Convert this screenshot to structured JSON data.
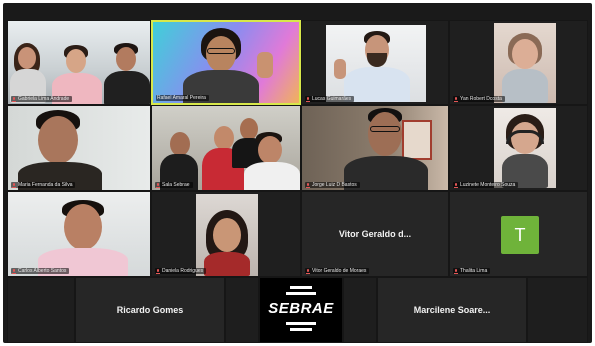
{
  "participants": [
    {
      "name": "Gabriela Lima Andrade",
      "muted": true
    },
    {
      "name": "Yan Robert Dcosta",
      "muted": true
    },
    {
      "name": "Rafael Amaral Pereira",
      "muted": false
    },
    {
      "name": "Maria Fernanda da Silva",
      "muted": true
    },
    {
      "name": "Lucas Guimarães",
      "muted": true
    },
    {
      "name": "Sala Sebrae",
      "muted": true
    },
    {
      "name": "Jorge Luiz D Bastos",
      "muted": true
    },
    {
      "name": "Luzinete Monteiro Souza",
      "muted": true
    },
    {
      "name": "Carlos Alberto Santos",
      "muted": true
    },
    {
      "name": "Daniela Rodrigues",
      "muted": true
    },
    {
      "name": "Vitor Geraldo d...",
      "subname": "Vitor Geraldo de Moraes",
      "muted": true
    },
    {
      "name": "Thalita Lima",
      "initial": "T",
      "muted": true
    },
    {
      "name": "Ricardo Gomes"
    },
    {
      "name": "SEBRAE"
    },
    {
      "name": "Marcilene Soare..."
    }
  ],
  "logo": {
    "text": "SEBRAE"
  },
  "colors": {
    "background": "#1a1a1a",
    "active_speaker": "#d8e84a",
    "avatar_green": "#6fb33a",
    "muted_red": "#e25555"
  }
}
